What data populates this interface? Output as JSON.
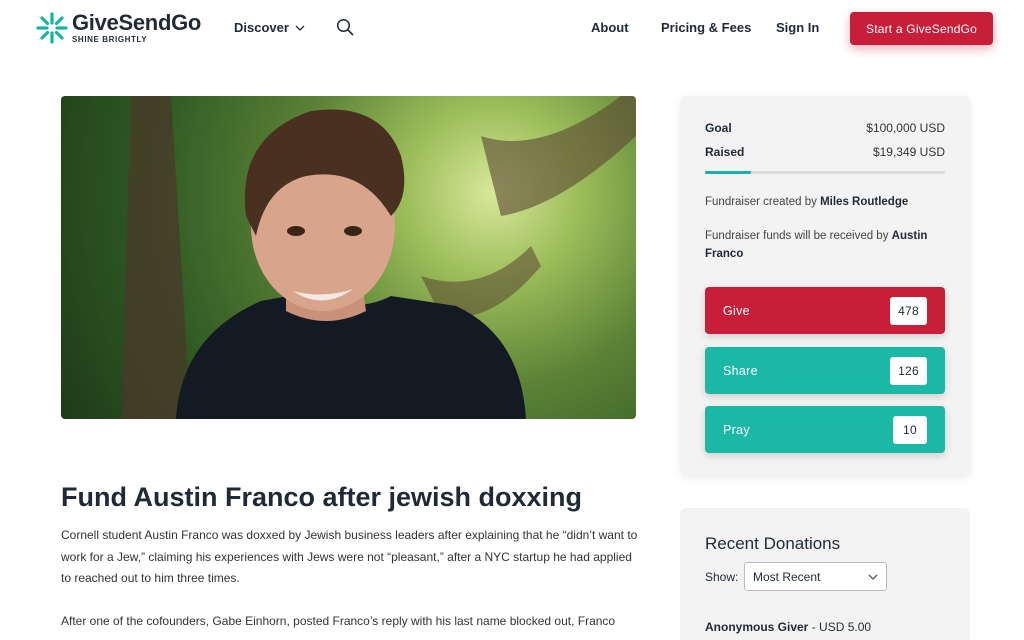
{
  "header": {
    "logo_name": "GiveSendGo",
    "logo_tagline": "SHINE BRIGHTLY",
    "nav_discover": "Discover",
    "nav_about": "About",
    "nav_pricing": "Pricing & Fees",
    "nav_signin": "Sign In",
    "start_button": "Start a GiveSendGo"
  },
  "campaign": {
    "title": "Fund Austin Franco after jewish doxxing",
    "description_p1": "Cornell student Austin Franco was doxxed by Jewish business leaders after explaining that he “didn’t want to work for a Jew,” claiming his experiences with Jews were not “pleasant,” after a NYC startup he had applied to reached out to him three times.",
    "description_p2": "After one of the cofounders, Gabe Einhorn, posted Franco’s reply with his last name blocked out, Franco"
  },
  "sidebar": {
    "goal_label": "Goal",
    "goal_value": "$100,000 USD",
    "raised_label": "Raised",
    "raised_value": "$19,349 USD",
    "progress_fraction": 0.19349,
    "created_by_prefix": "Fundraiser created by",
    "created_by_name": "Miles Routledge",
    "received_by_prefix": "Fundraiser funds will be received by",
    "received_by_name": "Austin Franco",
    "actions": [
      {
        "label": "Give",
        "count": "478",
        "color": "#c81e3a"
      },
      {
        "label": "Share",
        "count": "126",
        "color": "#1bb8a6"
      },
      {
        "label": "Pray",
        "count": "10",
        "color": "#1bb8a6"
      }
    ]
  },
  "recent_donations": {
    "title": "Recent Donations",
    "show_label": "Show:",
    "show_selected": "Most Recent",
    "first_donor_name": "Anonymous Giver",
    "first_donor_amount": "- USD 5.00"
  },
  "colors": {
    "brand_red": "#c81e3a",
    "teal": "#1bb8a6",
    "dark_text": "#1f2a36"
  }
}
